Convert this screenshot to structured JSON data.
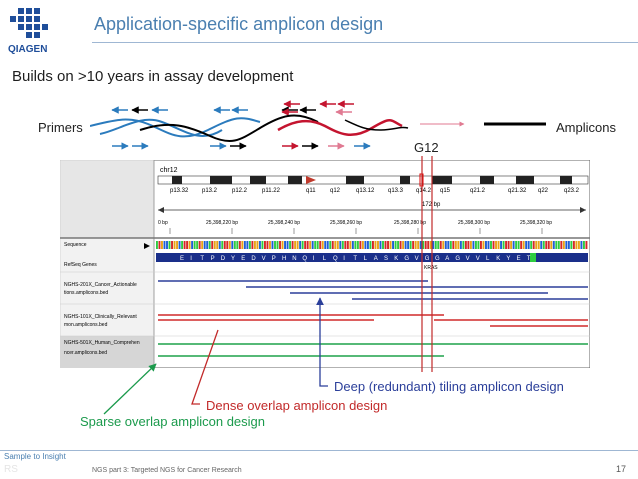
{
  "slide": {
    "title": "Application-specific amplicon design",
    "subtitle": "Builds on >10 years in assay development",
    "page_number": "17",
    "footer_left": "Sample to Insight",
    "footer_center": "NGS part 3: Targeted NGS for Cancer Research",
    "footer_ghost": "RS"
  },
  "logo": {
    "text": "QIAGEN",
    "color": "#1f4e9a"
  },
  "schematic": {
    "primers_label": "Primers",
    "amplicons_label": "Amplicons",
    "g12_label": "G12",
    "colors": {
      "blue": "#2b7bbd",
      "black": "#000000",
      "red": "#c4142f",
      "pink": "#e07a92"
    }
  },
  "igv": {
    "chromosome": "chr12",
    "cytobands": [
      "p13.32",
      "p13.2",
      "p12.2",
      "p11.22",
      "q11",
      "q12",
      "q13.12",
      "q13.3",
      "q14.2",
      "q15",
      "q21.2",
      "q21.32",
      "q22",
      "q23.2"
    ],
    "span_label": "172 bp",
    "coordinate_ticks": [
      "0 bp",
      "25,398,220 bp",
      "25,398,240 bp",
      "25,398,260 bp",
      "25,398,280 bp",
      "25,398,300 bp",
      "25,398,320 bp"
    ],
    "track_names": [
      "Sequence",
      "RefSeq Genes",
      "NGHS-201X_Cancer_Actionable",
      "tions.amplicons.bed",
      "NGHS-101X_Clinically_Relevant",
      "mon.amplicons.bed",
      "NGHS-501X_Human_Comprehen",
      "ncer.amplicons.bed"
    ],
    "amino_acids": [
      "E",
      "I",
      "T",
      "P",
      "D",
      "Y",
      "E",
      "D",
      "V",
      "P",
      "H",
      "N",
      "Q",
      "I",
      "L",
      "Q",
      "I",
      "T",
      "L",
      "A",
      "S",
      "K",
      "G",
      "V",
      "G",
      "G",
      "A",
      "G",
      "V",
      "V",
      "L",
      "K",
      "Y",
      "E",
      "T"
    ],
    "gene": "KRAS"
  },
  "annotations": {
    "deep": "Deep (redundant)  tiling amplicon design",
    "dense": "Dense overlap amplicon design",
    "sparse": "Sparse overlap amplicon design",
    "colors": {
      "deep": "#2b3f9a",
      "dense": "#c22a2a",
      "sparse": "#1b9a4c"
    }
  }
}
